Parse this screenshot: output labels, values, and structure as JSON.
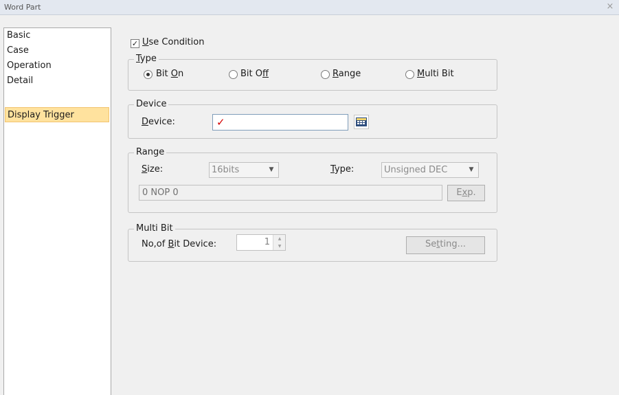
{
  "window": {
    "title": "Word Part",
    "close_glyph": "×"
  },
  "sidebar": {
    "items": [
      {
        "label": "Basic"
      },
      {
        "label": "Case"
      },
      {
        "label": "Operation"
      },
      {
        "label": "Detail"
      },
      {
        "label": "Display Trigger",
        "active": true
      }
    ]
  },
  "use_condition": {
    "label_u": "U",
    "label_rest": "se Condition",
    "checked": true
  },
  "type_group": {
    "title_u": "T",
    "title_rest": "ype",
    "options": [
      {
        "pre": "Bit ",
        "u": "O",
        "post": "n",
        "checked": true
      },
      {
        "pre": "Bit O",
        "u": "f",
        "post": "f",
        "checked": false
      },
      {
        "pre": "",
        "u": "R",
        "post": "ange",
        "checked": false
      },
      {
        "pre": "",
        "u": "M",
        "post": "ulti Bit",
        "checked": false
      }
    ]
  },
  "device_group": {
    "title": "Device",
    "label_u": "D",
    "label_rest": "evice:",
    "value_mark": "✓",
    "value": "",
    "picker_icon": "device-picker-icon"
  },
  "range_group": {
    "title": "Range",
    "size_label_u": "S",
    "size_label_rest": "ize:",
    "size_value": "16bits",
    "type_label_u": "T",
    "type_label_rest": "ype:",
    "type_value": "Unsigned DEC",
    "expression": "0 NOP 0",
    "exp_pre": "E",
    "exp_u": "x",
    "exp_post": "p."
  },
  "multibit_group": {
    "title": "Multi Bit",
    "count_pre": "No,of ",
    "count_u": "B",
    "count_post": "it Device:",
    "count_value": "1",
    "setting_pre": "Se",
    "setting_u": "t",
    "setting_post": "ting..."
  },
  "colors": {
    "active_item": "#ffe29e",
    "checkmark": "#d40000"
  }
}
